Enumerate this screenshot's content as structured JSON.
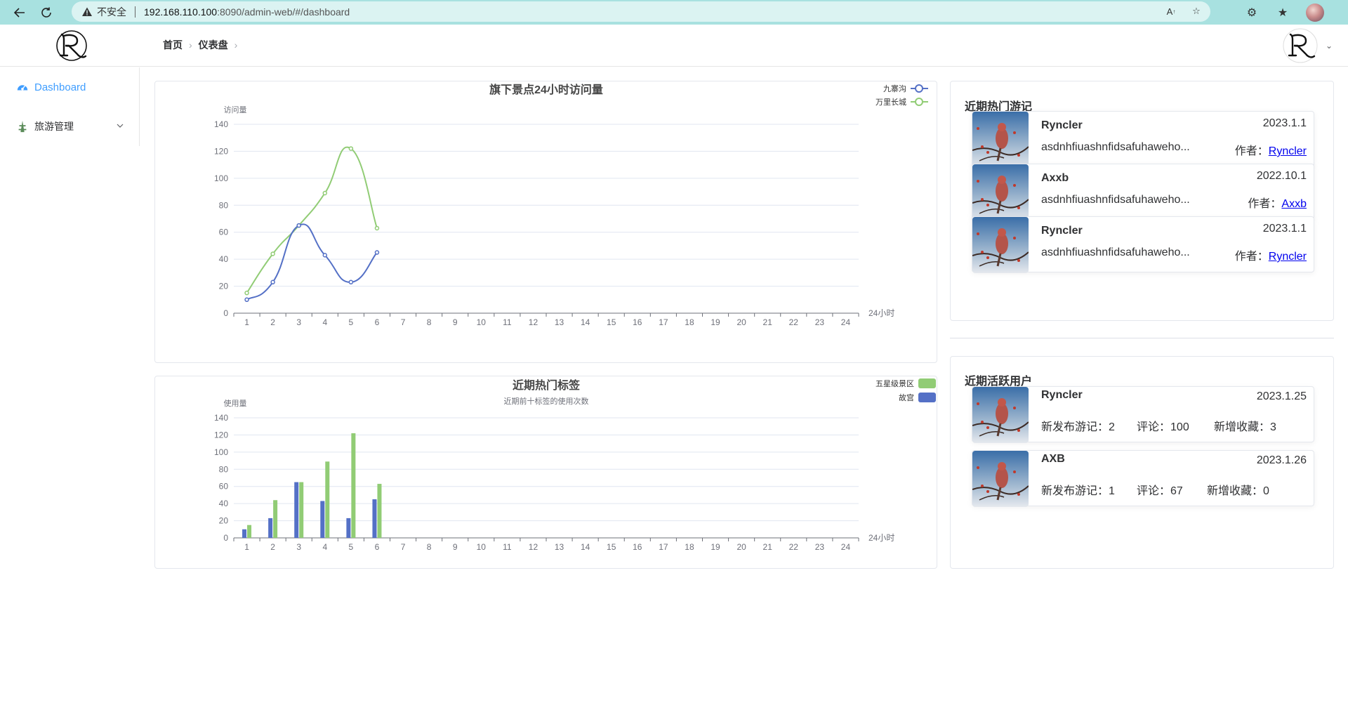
{
  "browser": {
    "insecure_label": "不安全",
    "url_host": "192.168.110.100",
    "url_rest": ":8090/admin-web/#/dashboard"
  },
  "header": {
    "breadcrumb": [
      "首页",
      "仪表盘"
    ]
  },
  "sidebar": {
    "items": [
      {
        "label": "Dashboard",
        "icon": "dashboard-icon",
        "active": true
      },
      {
        "label": "旅游管理",
        "icon": "tower-icon",
        "active": false
      }
    ]
  },
  "colors": {
    "blue": "#5470c6",
    "green": "#91cc75",
    "active": "#409eff"
  },
  "chart_data": [
    {
      "type": "line",
      "title": "旗下景点24小时访问量",
      "ylabel": "访问量",
      "xlabel": "24小时",
      "categories": [
        "1",
        "2",
        "3",
        "4",
        "5",
        "6",
        "7",
        "8",
        "9",
        "10",
        "11",
        "12",
        "13",
        "14",
        "15",
        "16",
        "17",
        "18",
        "19",
        "20",
        "21",
        "22",
        "23",
        "24"
      ],
      "ylim": [
        0,
        140
      ],
      "yticks": [
        0,
        20,
        40,
        60,
        80,
        100,
        120,
        140
      ],
      "smooth": true,
      "legend_position": "top-right",
      "series": [
        {
          "name": "九寨沟",
          "color": "#5470c6",
          "values": [
            10,
            23,
            65,
            43,
            23,
            45
          ]
        },
        {
          "name": "万里长城",
          "color": "#91cc75",
          "values": [
            15,
            44,
            65,
            89,
            122,
            63
          ]
        }
      ]
    },
    {
      "type": "bar",
      "title": "近期热门标签",
      "subtitle": "近期前十标签的使用次数",
      "ylabel": "使用量",
      "xlabel": "24小时",
      "categories": [
        "1",
        "2",
        "3",
        "4",
        "5",
        "6",
        "7",
        "8",
        "9",
        "10",
        "11",
        "12",
        "13",
        "14",
        "15",
        "16",
        "17",
        "18",
        "19",
        "20",
        "21",
        "22",
        "23",
        "24"
      ],
      "ylim": [
        0,
        140
      ],
      "yticks": [
        0,
        20,
        40,
        60,
        80,
        100,
        120,
        140
      ],
      "legend_position": "top-right",
      "series": [
        {
          "name": "故宫",
          "color": "#5470c6",
          "values": [
            10,
            23,
            65,
            43,
            23,
            45
          ]
        },
        {
          "name": "五星级景区",
          "color": "#91cc75",
          "values": [
            15,
            44,
            65,
            89,
            122,
            63
          ]
        }
      ]
    }
  ],
  "journals": {
    "title": "近期热门游记",
    "author_label": "作者：",
    "items": [
      {
        "name": "Ryncler",
        "date": "2023.1.1",
        "desc": "asdnhfiuashnfidsafuhaweho...",
        "author": "Ryncler"
      },
      {
        "name": "Axxb",
        "date": "2022.10.1",
        "desc": "asdnhfiuashnfidsafuhaweho...",
        "author": "Axxb"
      },
      {
        "name": "Ryncler",
        "date": "2023.1.1",
        "desc": "asdnhfiuashnfidsafuhaweho...",
        "author": "Ryncler"
      }
    ]
  },
  "active_users": {
    "title": "近期活跃用户",
    "posts_label": "新发布游记：",
    "comments_label": "评论：",
    "favorites_label": "新增收藏：",
    "items": [
      {
        "name": "Ryncler",
        "date": "2023.1.25",
        "posts": "2",
        "comments": "100",
        "favorites": "3"
      },
      {
        "name": "AXB",
        "date": "2023.1.26",
        "posts": "1",
        "comments": "67",
        "favorites": "0"
      }
    ]
  }
}
